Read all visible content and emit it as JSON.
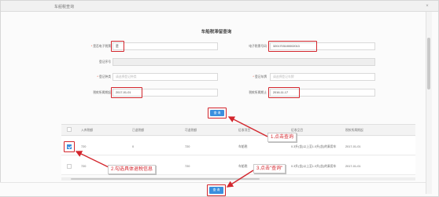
{
  "window": {
    "title": "车船税查询",
    "close_glyph": "×"
  },
  "form": {
    "title": "车船税滞留查询",
    "fields": {
      "rescue_code": {
        "label": "是否电子税票",
        "value": "是"
      },
      "ticket_no": {
        "label": "电子税票号码",
        "value": "3201703100002013"
      },
      "reg_no": {
        "label": "登记序号",
        "value": ""
      },
      "vehicle_type": {
        "label": "登记种类",
        "placeholder": "请选择登记种类"
      },
      "vehicle_no": {
        "label": "登记车牌",
        "placeholder": "请选择登记车牌"
      },
      "date_from": {
        "label": "税款所属期起",
        "value": "2017-01-01"
      },
      "date_to": {
        "label": "税款所属期止",
        "value": "2016-11-17"
      }
    },
    "query_button": "查 询"
  },
  "table": {
    "headers": [
      "入库税额",
      "已退税额",
      "可退税额",
      "征收项目",
      "征收品目",
      "税款所属期起"
    ],
    "rows": [
      {
        "checked": true,
        "cells": [
          "720",
          "0",
          "720",
          "车船税",
          "0.3升(含)以上至1.0升(含)的乘用车",
          "2017-01-01"
        ]
      },
      {
        "checked": false,
        "cells": [
          "720",
          "",
          "720",
          "车船税",
          "0.3升(含)以上至1.0升(含)的乘用车",
          "2017-01-01"
        ]
      }
    ]
  },
  "footer": {
    "confirm_button": "查 询"
  },
  "annotations": {
    "step1": "1.点击查询",
    "step2": "2.勾选具体退税信息",
    "step3": "3.点击\"查询\""
  },
  "colors": {
    "highlight": "#d3262d",
    "primary": "#3a8fde"
  }
}
